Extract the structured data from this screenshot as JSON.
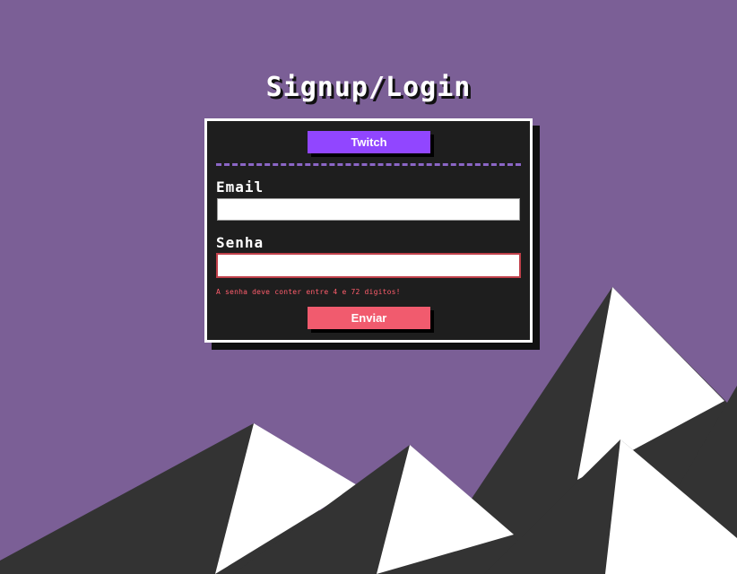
{
  "page": {
    "title": "Signup/Login"
  },
  "form": {
    "twitch_label": "Twitch",
    "email_label": "Email",
    "email_value": "",
    "senha_label": "Senha",
    "senha_value": "",
    "error_message": "A senha deve conter entre 4 e 72 digitos!",
    "submit_label": "Enviar"
  },
  "colors": {
    "background": "#7b5f96",
    "card": "#1e1e1e",
    "twitch_button": "#9146ff",
    "submit_button": "#f15b6e",
    "error_text": "#ff5d6c",
    "divider": "#8b66c6",
    "mountain_dark": "#333333",
    "mountain_snow": "#ffffff"
  }
}
